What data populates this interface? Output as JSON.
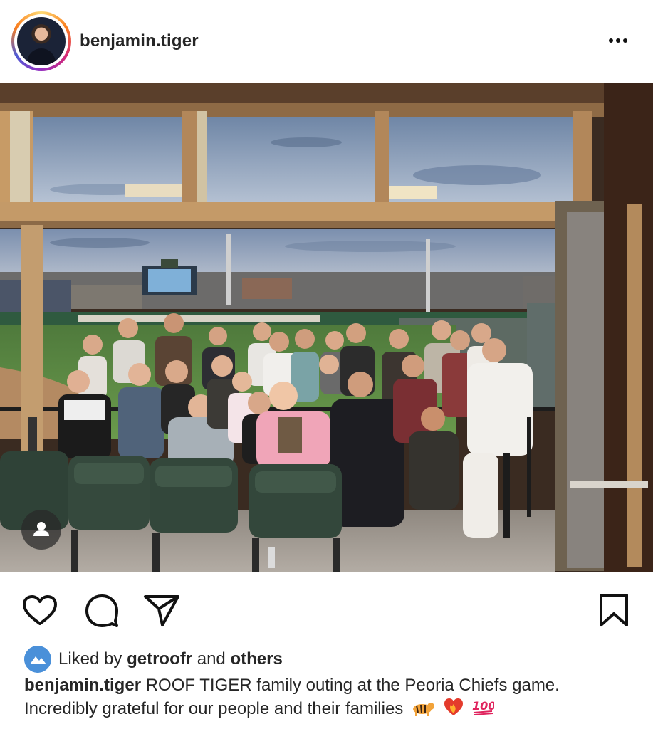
{
  "post": {
    "username": "benjamin.tiger",
    "more_icon": "more-horizontal-icon",
    "image_alt": "Group photo in a stadium suite overlooking a baseball field"
  },
  "actions": {
    "like_icon": "heart-icon",
    "comment_icon": "comment-icon",
    "share_icon": "send-icon",
    "save_icon": "bookmark-icon",
    "user_tag_icon": "user-tag-icon"
  },
  "likes": {
    "prefix": "Liked by",
    "user": "getroofr",
    "connector": "and",
    "others": "others"
  },
  "caption": {
    "username": "benjamin.tiger",
    "text": "ROOF TIGER family outing at the Peoria Chiefs game. Incredibly grateful for our people and their families",
    "emojis": [
      "tiger",
      "heart-on-fire",
      "hundred-points"
    ]
  },
  "colors": {
    "story_ring_start": "#feda75",
    "story_ring_end": "#d62976",
    "text_primary": "#262626",
    "liker_avatar": "#4a90d9"
  }
}
